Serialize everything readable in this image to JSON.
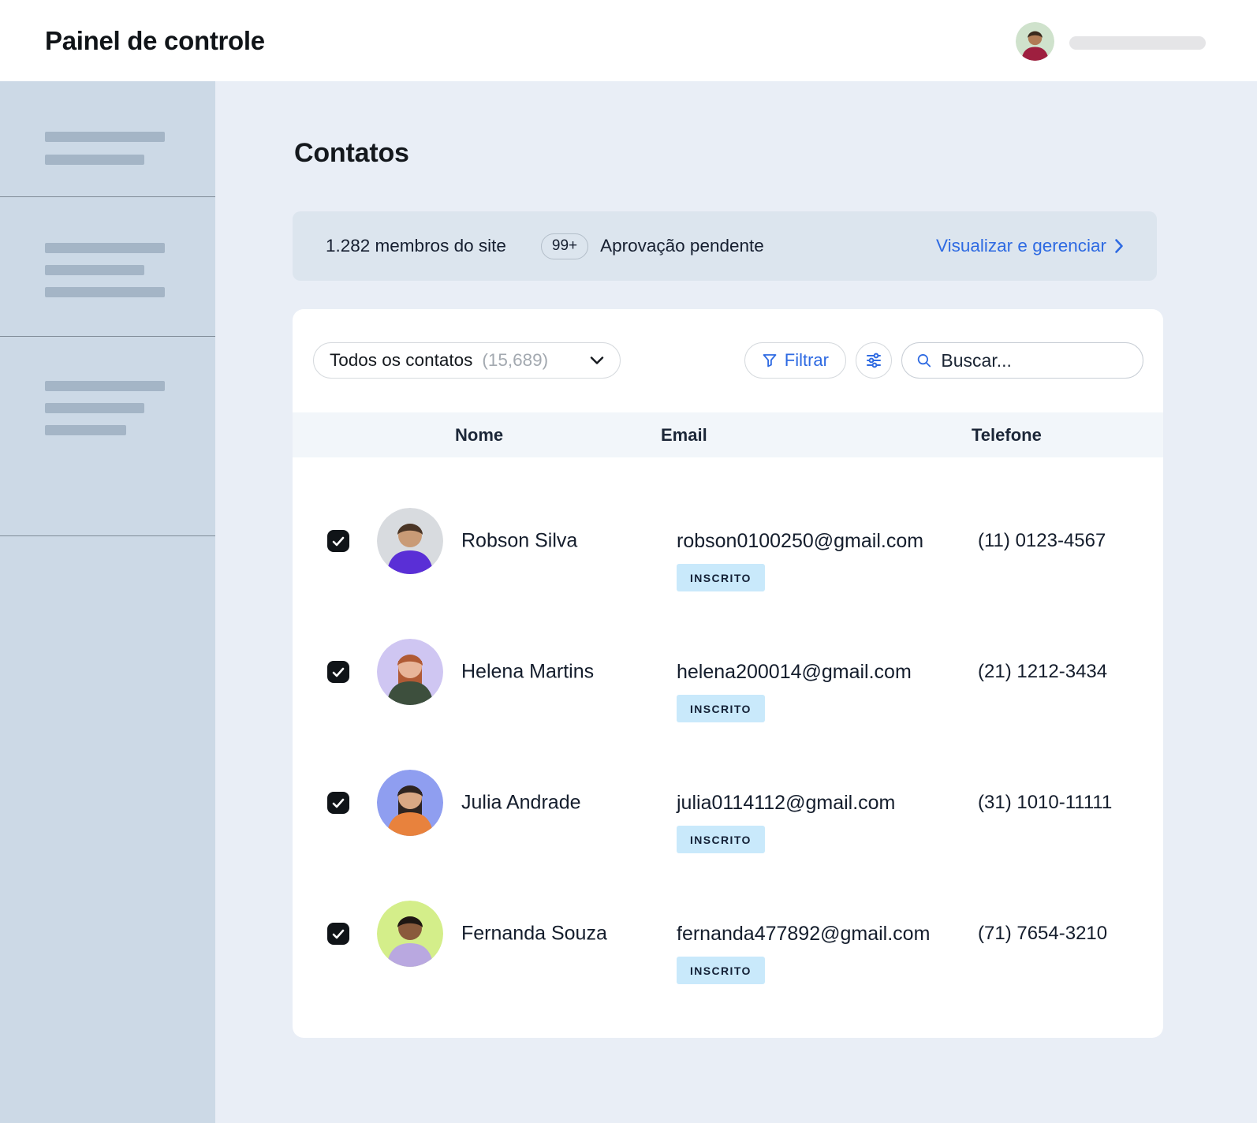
{
  "colors": {
    "accent_blue": "#2e6ae2",
    "main_bg": "#e9eef6",
    "sidebar_bg": "#ccd9e6",
    "banner_bg": "#dce5ee",
    "badge_bg": "#c9e9fb",
    "checkbox_bg": "#101418",
    "dark_text": "#141d2c"
  },
  "header": {
    "title": "Painel de controle"
  },
  "page": {
    "title": "Contatos"
  },
  "banner": {
    "members_text": "1.282 membros do site",
    "badge": "99+",
    "pending_text": "Aprovação pendente",
    "link_text": "Visualizar e gerenciar"
  },
  "toolbar": {
    "dropdown_label": "Todos os contatos",
    "dropdown_count": "(15,689)",
    "filter_label": "Filtrar",
    "search_placeholder": "Buscar..."
  },
  "table": {
    "columns": {
      "name": "Nome",
      "email": "Email",
      "phone": "Telefone"
    },
    "rows": [
      {
        "name": "Robson Silva",
        "email": "robson0100250@gmail.com",
        "status": "INSCRITO",
        "phone": "(11) 0123-4567",
        "avatar": {
          "bg": "#d8dbdf",
          "shirt": "#5a2fd6",
          "skin": "#c99b76",
          "hair": "#4a3526"
        }
      },
      {
        "name": "Helena Martins",
        "email": "helena200014@gmail.com",
        "status": "INSCRITO",
        "phone": "(21) 1212-3434",
        "avatar": {
          "bg": "#cfc6f2",
          "shirt": "#3d4f3d",
          "skin": "#e8b59a",
          "hair": "#b05a35"
        }
      },
      {
        "name": "Julia Andrade",
        "email": "julia0114112@gmail.com",
        "status": "INSCRITO",
        "phone": "(31) 1010-11111",
        "avatar": {
          "bg": "#8f9ef0",
          "shirt": "#e8823d",
          "skin": "#d9a884",
          "hair": "#2e2420"
        }
      },
      {
        "name": "Fernanda Souza",
        "email": "fernanda477892@gmail.com",
        "status": "INSCRITO",
        "phone": "(71) 7654-3210",
        "avatar": {
          "bg": "#d4ee8a",
          "shirt": "#b9a8e0",
          "skin": "#8a5a3c",
          "hair": "#1f1713"
        }
      }
    ]
  },
  "topbar_avatar": {
    "bg": "#cfe2cc",
    "shirt": "#9e1f3f",
    "skin": "#b07b55",
    "hair": "#3a2a1e"
  }
}
